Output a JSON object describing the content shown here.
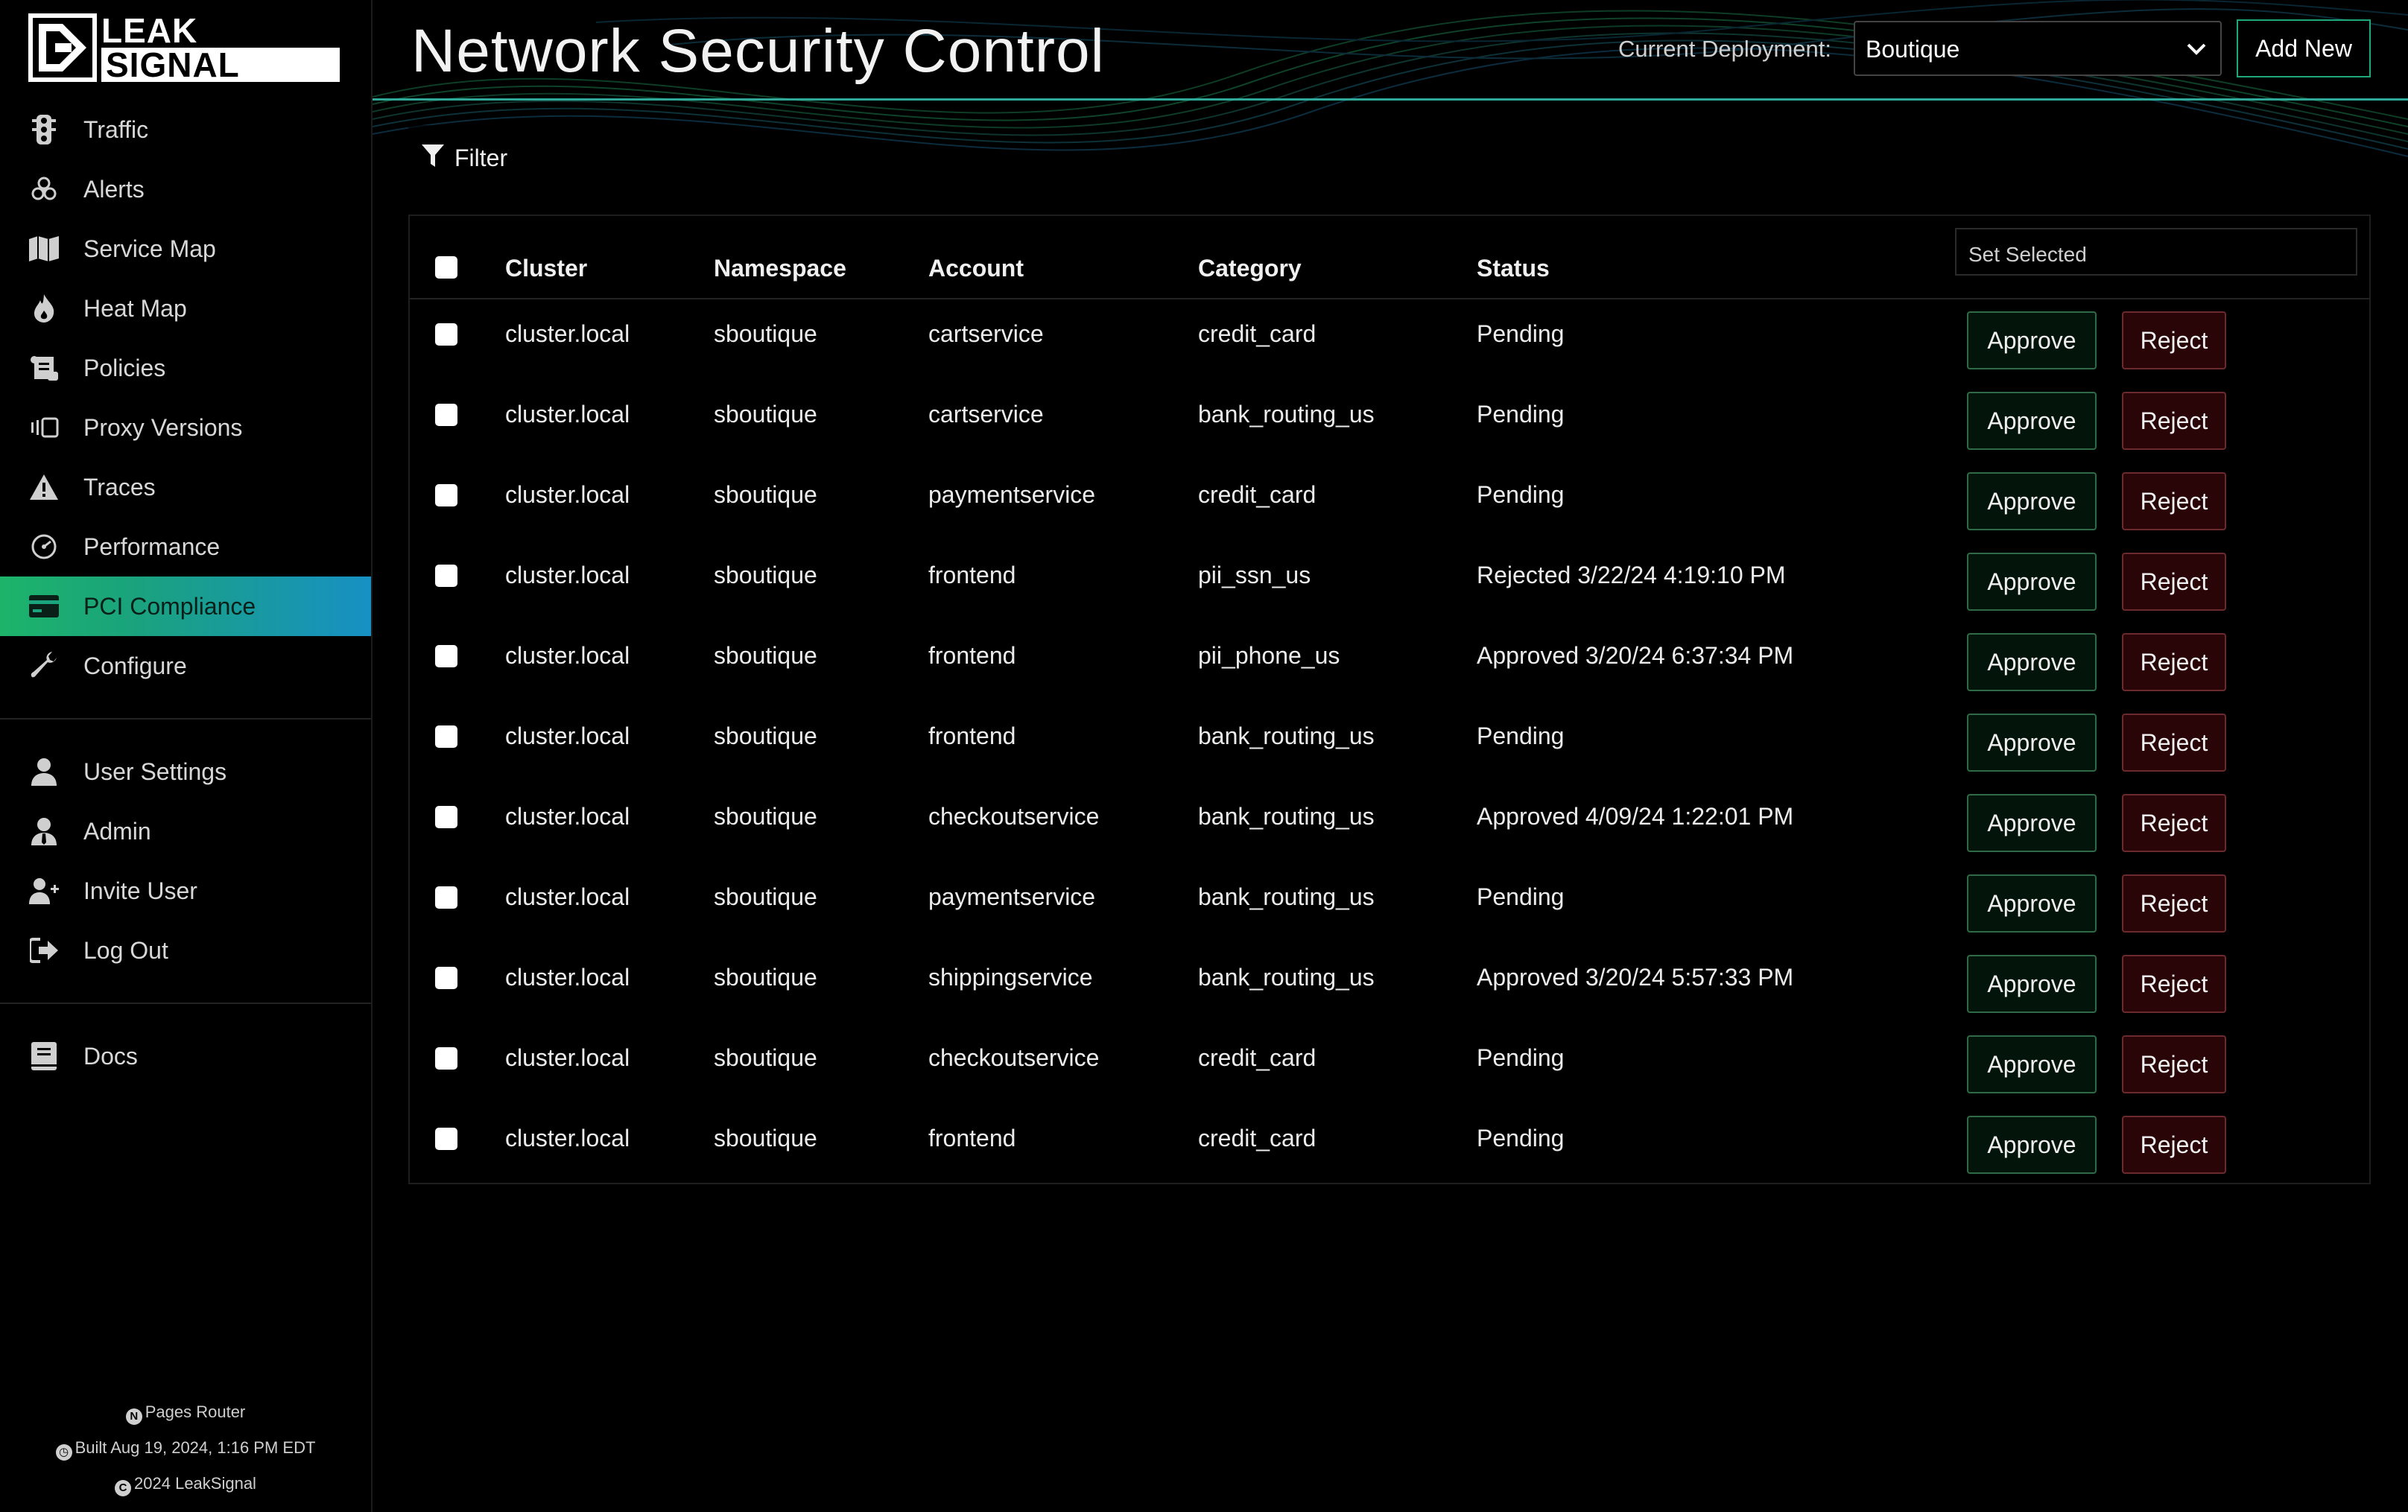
{
  "brand": {
    "line1": "LEAK",
    "line2": "SIGNAL"
  },
  "sidebar": {
    "items": [
      {
        "label": "Traffic",
        "icon": "traffic-light-icon"
      },
      {
        "label": "Alerts",
        "icon": "biohazard-icon"
      },
      {
        "label": "Service Map",
        "icon": "map-icon"
      },
      {
        "label": "Heat Map",
        "icon": "flame-icon"
      },
      {
        "label": "Policies",
        "icon": "scroll-icon"
      },
      {
        "label": "Proxy Versions",
        "icon": "proxy-icon"
      },
      {
        "label": "Traces",
        "icon": "warning-icon"
      },
      {
        "label": "Performance",
        "icon": "gauge-icon"
      },
      {
        "label": "PCI Compliance",
        "icon": "credit-card-icon",
        "active": true
      },
      {
        "label": "Configure",
        "icon": "wrench-icon"
      }
    ],
    "user_items": [
      {
        "label": "User Settings",
        "icon": "user-icon"
      },
      {
        "label": "Admin",
        "icon": "admin-icon"
      },
      {
        "label": "Invite User",
        "icon": "user-plus-icon"
      },
      {
        "label": "Log Out",
        "icon": "logout-icon"
      }
    ],
    "docs_items": [
      {
        "label": "Docs",
        "icon": "book-icon"
      }
    ],
    "footer": {
      "router": "Pages Router",
      "built": "Built Aug 19, 2024, 1:16 PM EDT",
      "copyright": "2024 LeakSignal"
    }
  },
  "header": {
    "title": "Network Security Control",
    "deployment_label": "Current Deployment:",
    "deployment_value": "Boutique",
    "add_new_label": "Add New"
  },
  "toolbar": {
    "filter_label": "Filter"
  },
  "table": {
    "columns": [
      "Cluster",
      "Namespace",
      "Account",
      "Category",
      "Status"
    ],
    "set_selected_placeholder": "Set Selected",
    "approve_label": "Approve",
    "reject_label": "Reject",
    "rows": [
      [
        "cluster.local",
        "sboutique",
        "cartservice",
        "credit_card",
        "Pending"
      ],
      [
        "cluster.local",
        "sboutique",
        "cartservice",
        "bank_routing_us",
        "Pending"
      ],
      [
        "cluster.local",
        "sboutique",
        "paymentservice",
        "credit_card",
        "Pending"
      ],
      [
        "cluster.local",
        "sboutique",
        "frontend",
        "pii_ssn_us",
        "Rejected 3/22/24 4:19:10 PM"
      ],
      [
        "cluster.local",
        "sboutique",
        "frontend",
        "pii_phone_us",
        "Approved 3/20/24 6:37:34 PM"
      ],
      [
        "cluster.local",
        "sboutique",
        "frontend",
        "bank_routing_us",
        "Pending"
      ],
      [
        "cluster.local",
        "sboutique",
        "checkoutservice",
        "bank_routing_us",
        "Approved 4/09/24 1:22:01 PM"
      ],
      [
        "cluster.local",
        "sboutique",
        "paymentservice",
        "bank_routing_us",
        "Pending"
      ],
      [
        "cluster.local",
        "sboutique",
        "shippingservice",
        "bank_routing_us",
        "Approved 3/20/24 5:57:33 PM"
      ],
      [
        "cluster.local",
        "sboutique",
        "checkoutservice",
        "credit_card",
        "Pending"
      ],
      [
        "cluster.local",
        "sboutique",
        "frontend",
        "credit_card",
        "Pending"
      ]
    ]
  },
  "colors": {
    "accent_green": "#1ea97c",
    "active_gradient_start": "#1db46a",
    "active_gradient_end": "#1790c4",
    "approve_bg": "#03140a",
    "reject_bg": "#2a0508"
  }
}
